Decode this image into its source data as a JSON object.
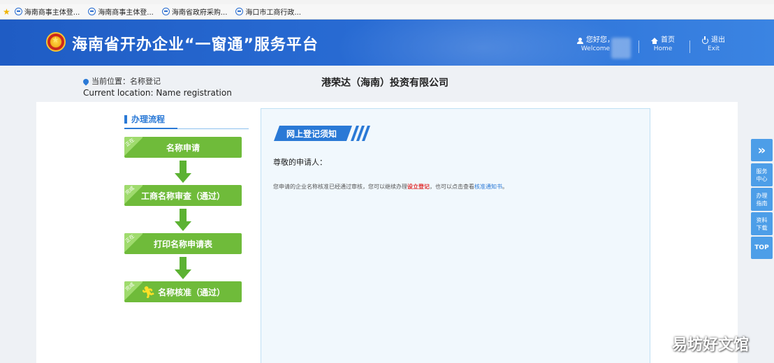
{
  "bookmarks": [
    {
      "label": "海南商事主体登..."
    },
    {
      "label": "海南商事主体登..."
    },
    {
      "label": "海南省政府采购..."
    },
    {
      "label": "海口市工商行政..."
    }
  ],
  "header": {
    "title": "海南省开办企业“一窗通”服务平台",
    "user_label": "您好您，",
    "user_label_en": "Welcome",
    "home_label": "首页",
    "home_label_en": "Home",
    "exit_label": "退出",
    "exit_label_en": "Exit",
    "separator": "|"
  },
  "location": {
    "label_cn": "当前位置：名称登记",
    "label_en": "Current location: Name registration"
  },
  "company_name": "港荣达（海南）投资有限公司",
  "process": {
    "title": "办理流程",
    "steps": [
      {
        "tag": "正在",
        "label": "名称申请"
      },
      {
        "tag": "完成",
        "label": "工商名称审查（通过）"
      },
      {
        "tag": "正在",
        "label": "打印名称申请表"
      },
      {
        "tag": "完成",
        "label": "名称核准（通过）"
      }
    ]
  },
  "notice": {
    "tab_title": "网上登记须知",
    "greeting": "尊敬的申请人：",
    "message_prefix": "您申请的企业名称核准已经通过审核，您可以继续办理",
    "message_link_red": "设立登记",
    "message_middle": "，也可以点击查看",
    "message_link_blue": "核准通知书",
    "message_suffix": "。"
  },
  "side_toolbar": {
    "expand": "»",
    "items": [
      "服务中心",
      "办理指南",
      "资料下载"
    ],
    "top": "TOP"
  },
  "watermark": "易坊好文馆",
  "colors": {
    "header_blue": "#1f5cc4",
    "step_green": "#6fbb3a",
    "accent_blue": "#2a79d6",
    "link_red": "#e02b2b"
  }
}
